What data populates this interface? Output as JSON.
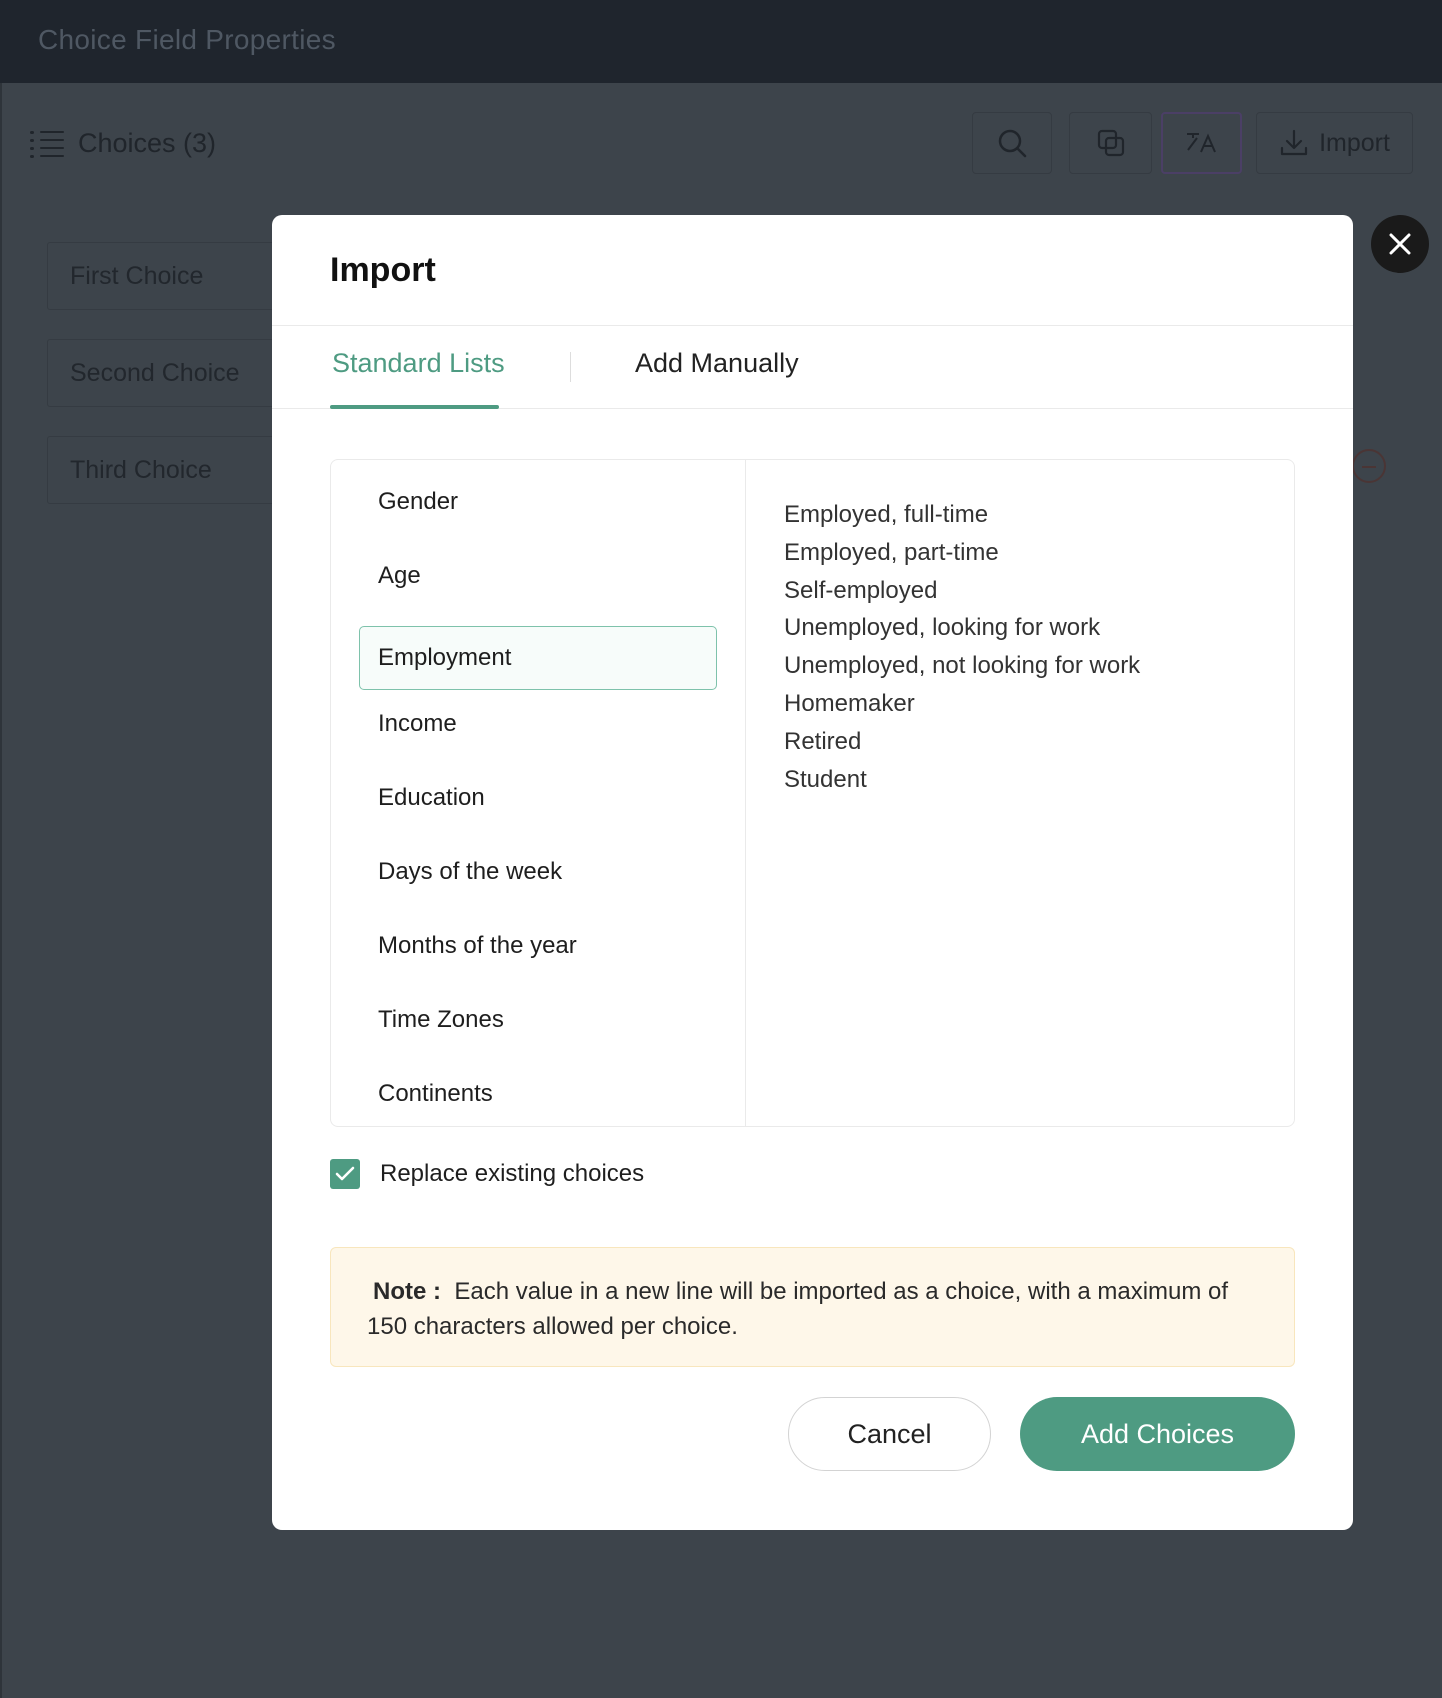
{
  "window": {
    "title": "Choice Field Properties"
  },
  "panel": {
    "choices_label": "Choices (3)",
    "toolbar": {
      "import_label": "Import"
    },
    "choices": [
      "First Choice",
      "Second Choice",
      "Third Choice"
    ]
  },
  "modal": {
    "title": "Import",
    "tabs": [
      {
        "label": "Standard Lists",
        "active": true
      },
      {
        "label": "Add Manually",
        "active": false
      }
    ],
    "categories": [
      "Gender",
      "Age",
      "Employment",
      "Income",
      "Education",
      "Days of the week",
      "Months of the year",
      "Time Zones",
      "Continents"
    ],
    "selected_category": "Employment",
    "options": [
      "Employed, full-time",
      "Employed, part-time",
      "Self-employed",
      "Unemployed, looking for work",
      "Unemployed, not looking for work",
      "Homemaker",
      "Retired",
      "Student"
    ],
    "replace_existing": {
      "label": "Replace existing choices",
      "checked": true
    },
    "note": {
      "label": "Note :",
      "text": "Each value in a new line will be imported as a choice, with a maximum of 150 characters allowed per choice."
    },
    "buttons": {
      "cancel": "Cancel",
      "add": "Add Choices"
    }
  },
  "colors": {
    "accent": "#4e9b82",
    "overlay": "#3d444b",
    "note_bg": "#fef7e9"
  }
}
